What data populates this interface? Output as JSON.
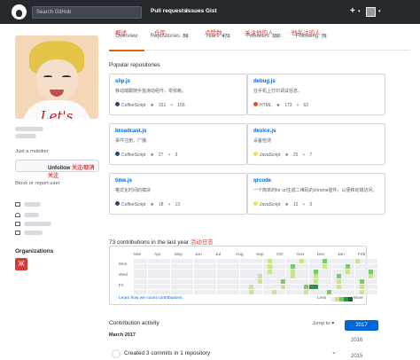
{
  "top": {
    "search": "Search GitHub",
    "nav": [
      "Pull requests",
      "Issues",
      "Gist"
    ],
    "plus": "+",
    "caret": "▾"
  },
  "profile": {
    "shirt_text": "Let's",
    "bio": "Just a mobiker",
    "unfollow": "Unfollow",
    "unfollow_note": "关注/取消关注",
    "block": "Block or report user",
    "orgs": "Organizations",
    "org_logo": "Ж"
  },
  "tabs": [
    {
      "label": "Overview",
      "count": "",
      "note": "概述"
    },
    {
      "label": "Repositories",
      "count": "59",
      "note": "仓库"
    },
    {
      "label": "Stars",
      "count": "473",
      "note": "点赞数"
    },
    {
      "label": "Followers",
      "count": "160",
      "note": "关注他的人"
    },
    {
      "label": "Following",
      "count": "76",
      "note": "他关注的人"
    }
  ],
  "popular": "Popular repositories",
  "repos": [
    {
      "name": "slip.js",
      "desc": "移动端跟随手指滑动组件，零依赖。",
      "lang": "CoffeeScript",
      "color": "#244776",
      "stars": "331",
      "forks": "156"
    },
    {
      "name": "debug.js",
      "desc": "在手机上打印调试信息。",
      "lang": "HTML",
      "color": "#e34c26",
      "stars": "173",
      "forks": "62"
    },
    {
      "name": "broadcast.js",
      "desc": "事件注册，广播",
      "lang": "CoffeeScript",
      "color": "#244776",
      "stars": "27",
      "forks": "3"
    },
    {
      "name": "device.js",
      "desc": "设备检测",
      "lang": "JavaScript",
      "color": "#f1e05a",
      "stars": "25",
      "forks": "7"
    },
    {
      "name": "time.js",
      "desc": "格式化时间的模块",
      "lang": "CoffeeScript",
      "color": "#244776",
      "stars": "18",
      "forks": "13"
    },
    {
      "name": "qrcode",
      "desc": "一个简单的for url生成二维码的chrome插件，以便移动端访问。",
      "lang": "JavaScript",
      "color": "#f1e05a",
      "stars": "13",
      "forks": "3"
    }
  ],
  "contrib": {
    "title": "73 contributions in the last year",
    "note": "活动日志",
    "months": [
      "Mar",
      "Apr",
      "May",
      "Jun",
      "Jul",
      "Aug",
      "Sep",
      "Oct",
      "Nov",
      "Dec",
      "Jan",
      "Feb"
    ],
    "days": [
      "Mon",
      "Wed",
      "Fri"
    ],
    "learn": "Learn how we count contributions.",
    "less": "Less",
    "more": "More"
  },
  "activity": {
    "title": "Contribution activity",
    "jump": "Jump to ▾",
    "month": "March 2017",
    "item": "Created 3 commits in 1 repository",
    "years": [
      "2017",
      "2016",
      "2015"
    ]
  }
}
